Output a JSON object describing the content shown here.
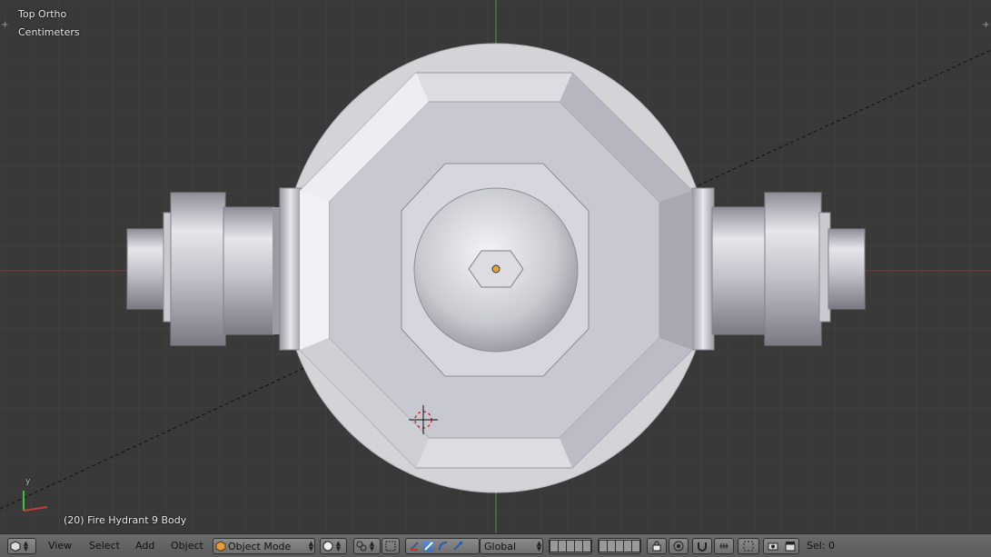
{
  "viewport": {
    "view_name": "Top Ortho",
    "units": "Centimeters",
    "object_info": "(20) Fire Hydrant 9 Body",
    "axis_y_label": "y",
    "colors": {
      "background": "#393939",
      "grid": "#474747",
      "x_axis": "#8a3a3a",
      "y_axis": "#4a9a3a"
    }
  },
  "header": {
    "editor_icon": "3d-view-icon",
    "menus": [
      "View",
      "Select",
      "Add",
      "Object"
    ],
    "mode": "Object Mode",
    "shading_icon": "solid-shading-icon",
    "pivot_icon": "pivot-icon",
    "transform_orientation": "Global",
    "status": "Sel: 0"
  }
}
